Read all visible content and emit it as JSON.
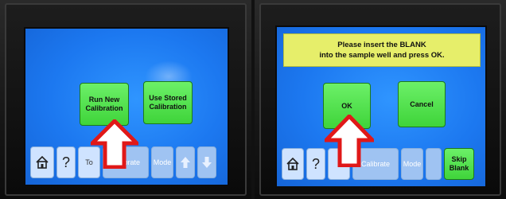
{
  "left_panel": {
    "buttons": {
      "run_new": [
        "Run New",
        "Calibration"
      ],
      "use_stored": [
        "Use Stored",
        "Calibration"
      ]
    },
    "taskbar": {
      "help": "?",
      "tools": "To",
      "calibrate": "Calibrate",
      "mode": "Mode"
    }
  },
  "right_panel": {
    "prompt": [
      "Please insert the BLANK",
      "into the sample well and press OK."
    ],
    "buttons": {
      "ok": "OK",
      "cancel": "Cancel"
    },
    "taskbar": {
      "help": "?",
      "calibrate": "Calibrate",
      "mode": "Mode",
      "skip_blank": [
        "Skip",
        "Blank"
      ]
    }
  },
  "icons": {
    "home": "home-icon",
    "arrow_up": "arrow-up-icon",
    "arrow_down": "arrow-down-icon",
    "pointer": "red-pointer-arrow"
  },
  "colors": {
    "screen_blue": "#1c78f0",
    "button_green": "#3fd43a",
    "banner_yellow": "#e6ee6a",
    "pointer_red": "#e01818"
  }
}
